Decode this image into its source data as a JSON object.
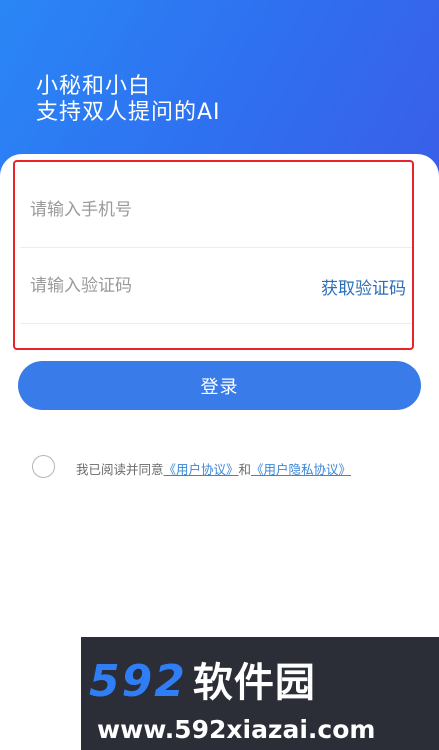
{
  "hero": {
    "line1": "小秘和小白",
    "line2": "支持双人提问的AI"
  },
  "form": {
    "phone_placeholder": "请输入手机号",
    "code_placeholder": "请输入验证码",
    "get_code_label": "获取验证码",
    "login_label": "登录"
  },
  "agreement": {
    "prefix": "我已阅读并同意",
    "user_agreement": "《用户协议》",
    "and": "和",
    "privacy_policy": "《用户隐私协议》",
    "checked": false
  },
  "watermark": {
    "number": "592",
    "name": "软件园",
    "url": "www.592xiazai.com"
  },
  "colors": {
    "primary": "#3a7bea",
    "link": "#3a86d6",
    "highlight": "#e8232a"
  }
}
